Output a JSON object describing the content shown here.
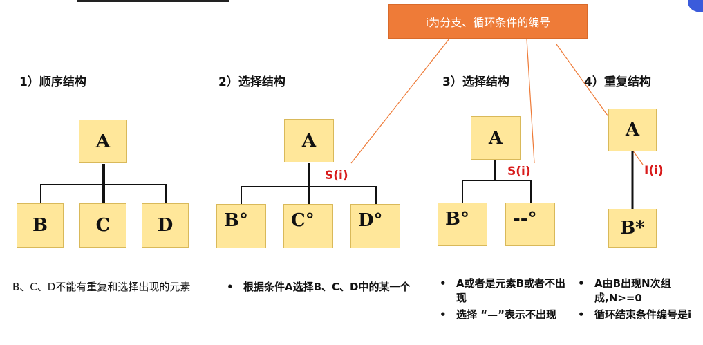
{
  "callout": {
    "text": "i为分支、循环条件的编号"
  },
  "sections": [
    {
      "heading": "1）顺序结构",
      "top": "A",
      "children": [
        "B",
        "C",
        "D"
      ],
      "description": "B、C、D不能有重复和选择出现的元素"
    },
    {
      "heading": "2）选择结构",
      "top": "A",
      "children": [
        "B°",
        "C°",
        "D°"
      ],
      "condition": "S(i)",
      "bullets": [
        "根据条件A选择B、C、D中的某一个"
      ]
    },
    {
      "heading": "3）选择结构",
      "top": "A",
      "children": [
        "B°",
        "--°"
      ],
      "condition": "S(i)",
      "bullets": [
        "A或者是元素B或者不出现",
        "选择 “—”表示不出现"
      ]
    },
    {
      "heading": "4）重复结构",
      "top": "A",
      "children": [
        "B*"
      ],
      "condition": "I(i)",
      "bullets": [
        "A由B出现N次组成,N>=0",
        "循环结束条件编号是i"
      ]
    }
  ],
  "bullet_symbol": "•"
}
